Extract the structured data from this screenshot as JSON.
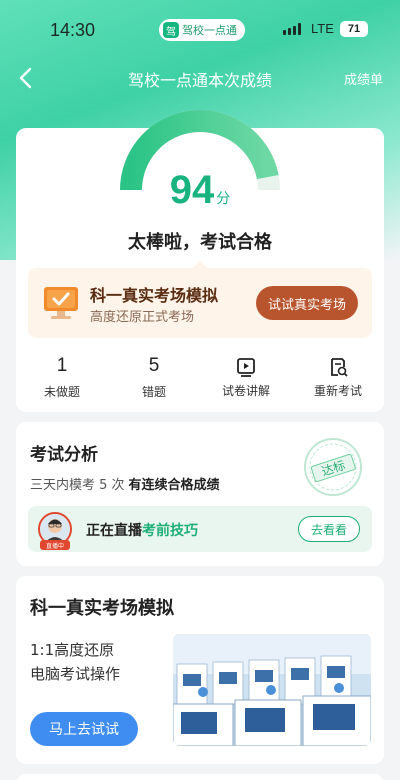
{
  "status_bar": {
    "time": "14:30",
    "app_pill": "驾校一点通",
    "app_pill_icon": "驾",
    "network": "LTE",
    "battery": "71"
  },
  "nav": {
    "title": "驾校一点通本次成绩",
    "right_link": "成绩单"
  },
  "score": {
    "value": "94",
    "unit": "分",
    "max": 100,
    "verdict": "太棒啦，考试合格",
    "gauge_color": "#2bbf86"
  },
  "promo": {
    "title": "科一真实考场模拟",
    "subtitle": "高度还原正式考场",
    "button": "试试真实考场"
  },
  "stats": [
    {
      "value": "1",
      "label": "未做题"
    },
    {
      "value": "5",
      "label": "错题"
    },
    {
      "icon": "video-play-icon",
      "label": "试卷讲解"
    },
    {
      "icon": "redo-exam-icon",
      "label": "重新考试"
    }
  ],
  "analysis": {
    "title": "考试分析",
    "line_prefix": "三天内模考 5 次",
    "line_bold": "有连续合格成绩",
    "stamp": "达标",
    "live_prefix": "正在直播",
    "live_topic": "考前技巧",
    "live_badge": "直播中",
    "live_button": "去看看"
  },
  "real_test": {
    "title": "科一真实考场模拟",
    "desc_line1": "1:1高度还原",
    "desc_line2": "电脑考试操作",
    "button": "马上去试试"
  },
  "colors": {
    "accent_green": "#19b37f",
    "promo_brown": "#b9552e",
    "action_blue": "#3f8df0"
  }
}
